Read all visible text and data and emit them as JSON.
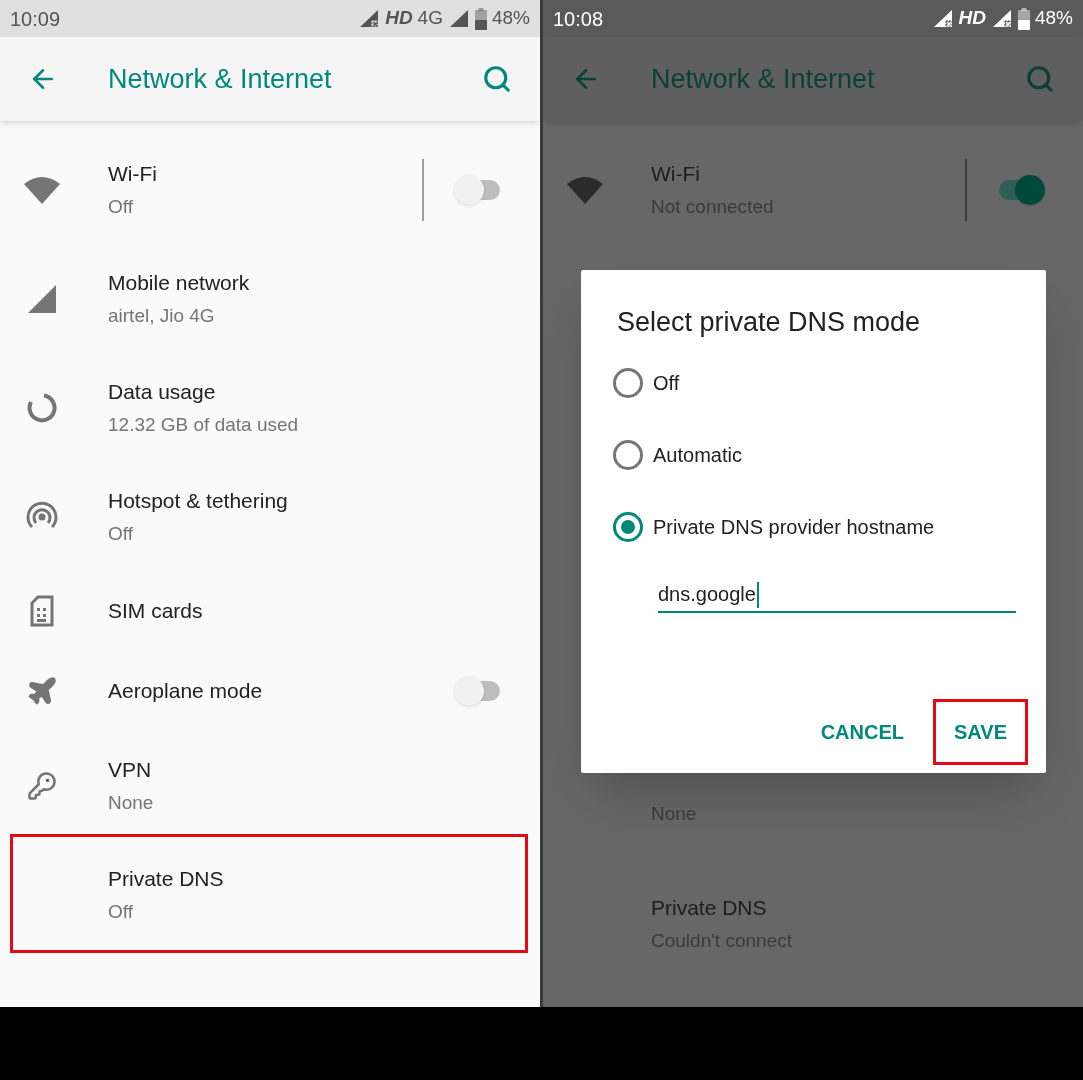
{
  "panels": [
    {
      "status_bar": {
        "time": "10:09",
        "items": [
          {
            "kind": "signal",
            "crossed": true
          },
          {
            "kind": "text",
            "text": "HD",
            "italic": true
          },
          {
            "kind": "text",
            "text": "4G",
            "italic": false
          },
          {
            "kind": "signal",
            "crossed": false
          },
          {
            "kind": "battery"
          },
          {
            "kind": "text",
            "text": "48%",
            "italic": false
          }
        ]
      },
      "app_bar": {
        "title": "Network & Internet"
      },
      "items": [
        {
          "title": "Wi-Fi",
          "subtitle": "Off",
          "toggle": {
            "on": false,
            "divider": true
          },
          "highlighted": false
        },
        {
          "title": "Mobile network",
          "subtitle": "airtel, Jio 4G",
          "highlighted": false
        },
        {
          "title": "Data usage",
          "subtitle": "12.32 GB of data used",
          "highlighted": false
        },
        {
          "title": "Hotspot & tethering",
          "subtitle": "Off",
          "highlighted": false
        },
        {
          "title": "SIM cards",
          "highlighted": false
        },
        {
          "title": "Aeroplane mode",
          "toggle": {
            "on": false,
            "divider": false
          },
          "highlighted": false
        },
        {
          "title": "VPN",
          "subtitle": "None",
          "highlighted": false
        },
        {
          "title": "Private DNS",
          "subtitle": "Off",
          "highlighted": true
        }
      ]
    },
    {
      "status_bar": {
        "time": "10:08",
        "items": [
          {
            "kind": "signal",
            "crossed": true
          },
          {
            "kind": "text",
            "text": "HD",
            "italic": true
          },
          {
            "kind": "signal",
            "crossed": true
          },
          {
            "kind": "battery"
          },
          {
            "kind": "text",
            "text": "48%",
            "italic": false
          }
        ]
      },
      "app_bar": {
        "title": "Network & Internet"
      },
      "items": [
        {
          "title": "Wi-Fi",
          "subtitle": "Not connected",
          "toggle": {
            "on": true,
            "divider": true
          },
          "highlighted": false
        },
        {
          "subtitle": "None",
          "highlighted": false
        },
        {
          "title": "Private DNS",
          "subtitle": "Couldn't connect",
          "highlighted": false
        }
      ],
      "dialog": {
        "title": "Select private DNS mode",
        "options": [
          {
            "label": "Off",
            "selected": false
          },
          {
            "label": "Automatic",
            "selected": false
          },
          {
            "label": "Private DNS provider hostname",
            "selected": true
          }
        ],
        "hostname_field": {
          "value": "dns.google"
        },
        "buttons": [
          {
            "label": "CANCEL",
            "highlighted": false
          },
          {
            "label": "SAVE",
            "highlighted": true
          }
        ]
      }
    }
  ]
}
